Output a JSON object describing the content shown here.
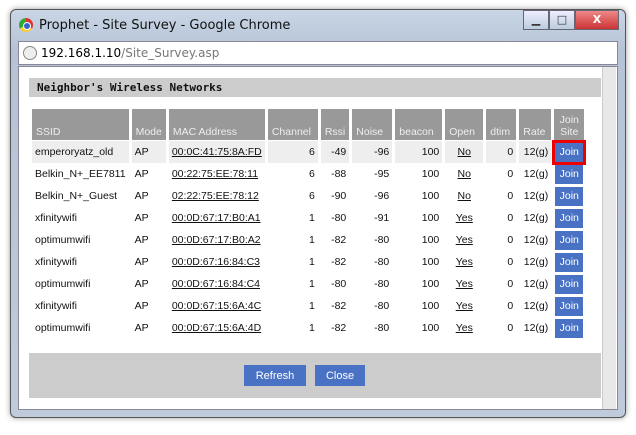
{
  "window": {
    "title": "Prophet - Site Survey - Google Chrome",
    "controls": {
      "min": "▁",
      "max": "□",
      "close": "X"
    }
  },
  "address": {
    "host": "192.168.1.10",
    "path": "/Site_Survey.asp"
  },
  "heading": "Neighbor's Wireless Networks",
  "columns": [
    "SSID",
    "Mode",
    "MAC Address",
    "Channel",
    "Rssi",
    "Noise",
    "beacon",
    "Open",
    "dtim",
    "Rate",
    "Join Site"
  ],
  "rows": [
    {
      "ssid": "emperoryatz_old",
      "mode": "AP",
      "mac": "00:0C:41:75:8A:FD",
      "channel": "6",
      "rssi": "-49",
      "noise": "-96",
      "beacon": "100",
      "open": "No",
      "dtim": "0",
      "rate": "12(g)",
      "join": "Join"
    },
    {
      "ssid": "Belkin_N+_EE7811",
      "mode": "AP",
      "mac": "00:22:75:EE:78:11",
      "channel": "6",
      "rssi": "-88",
      "noise": "-95",
      "beacon": "100",
      "open": "No",
      "dtim": "0",
      "rate": "12(g)",
      "join": "Join"
    },
    {
      "ssid": "Belkin_N+_Guest",
      "mode": "AP",
      "mac": "02:22:75:EE:78:12",
      "channel": "6",
      "rssi": "-90",
      "noise": "-96",
      "beacon": "100",
      "open": "No",
      "dtim": "0",
      "rate": "12(g)",
      "join": "Join"
    },
    {
      "ssid": "xfinitywifi",
      "mode": "AP",
      "mac": "00:0D:67:17:B0:A1",
      "channel": "1",
      "rssi": "-80",
      "noise": "-91",
      "beacon": "100",
      "open": "Yes",
      "dtim": "0",
      "rate": "12(g)",
      "join": "Join"
    },
    {
      "ssid": "optimumwifi",
      "mode": "AP",
      "mac": "00:0D:67:17:B0:A2",
      "channel": "1",
      "rssi": "-82",
      "noise": "-80",
      "beacon": "100",
      "open": "Yes",
      "dtim": "0",
      "rate": "12(g)",
      "join": "Join"
    },
    {
      "ssid": "xfinitywifi",
      "mode": "AP",
      "mac": "00:0D:67:16:84:C3",
      "channel": "1",
      "rssi": "-82",
      "noise": "-80",
      "beacon": "100",
      "open": "Yes",
      "dtim": "0",
      "rate": "12(g)",
      "join": "Join"
    },
    {
      "ssid": "optimumwifi",
      "mode": "AP",
      "mac": "00:0D:67:16:84:C4",
      "channel": "1",
      "rssi": "-80",
      "noise": "-80",
      "beacon": "100",
      "open": "Yes",
      "dtim": "0",
      "rate": "12(g)",
      "join": "Join"
    },
    {
      "ssid": "xfinitywifi",
      "mode": "AP",
      "mac": "00:0D:67:15:6A:4C",
      "channel": "1",
      "rssi": "-82",
      "noise": "-80",
      "beacon": "100",
      "open": "Yes",
      "dtim": "0",
      "rate": "12(g)",
      "join": "Join"
    },
    {
      "ssid": "optimumwifi",
      "mode": "AP",
      "mac": "00:0D:67:15:6A:4D",
      "channel": "1",
      "rssi": "-82",
      "noise": "-80",
      "beacon": "100",
      "open": "Yes",
      "dtim": "0",
      "rate": "12(g)",
      "join": "Join"
    }
  ],
  "buttons": {
    "refresh": "Refresh",
    "close": "Close"
  }
}
